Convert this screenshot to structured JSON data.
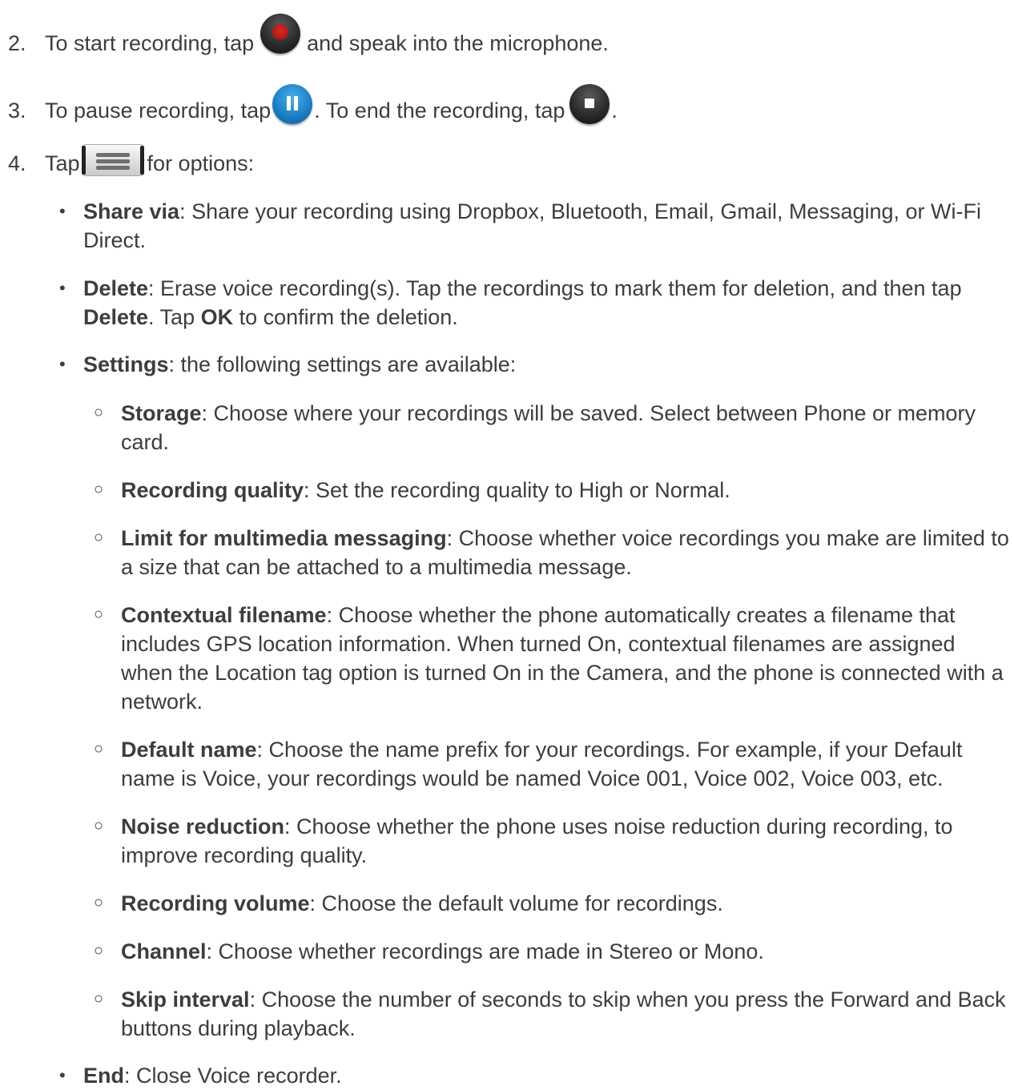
{
  "steps": [
    {
      "num": "2.",
      "pre": "To start recording, tap",
      "post": "and speak into the microphone."
    },
    {
      "num": "3.",
      "pre": "To pause recording, tap",
      "mid": ". To end the recording, tap",
      "post": "."
    },
    {
      "num": "4.",
      "pre": "Tap",
      "post": "for options:"
    }
  ],
  "icons": {
    "record": "record-button-icon",
    "pause": "pause-button-icon",
    "stop": "stop-button-icon",
    "menu": "menu-key-icon"
  },
  "options": {
    "share": {
      "term": "Share via",
      "text": ": Share your recording using Dropbox, Bluetooth, Email, Gmail, Messaging, or Wi-Fi Direct."
    },
    "delete": {
      "term": "Delete",
      "text1": ": Erase voice recording(s). Tap the recordings to mark them for deletion, and then tap ",
      "term2": "Delete",
      "text2": ". Tap ",
      "term3": "OK",
      "text3": " to confirm the deletion."
    },
    "settings": {
      "term": "Settings",
      "text": ": the following settings are available:"
    },
    "end": {
      "term": "End",
      "text": ": Close Voice recorder."
    }
  },
  "settings": [
    {
      "term": "Storage",
      "text": ": Choose where your recordings will be saved. Select between Phone or memory card."
    },
    {
      "term": "Recording quality",
      "text": ": Set the recording quality to High or Normal."
    },
    {
      "term": "Limit for multimedia messaging",
      "text": ": Choose whether voice recordings you make are limited to a size that can be attached to a multimedia message."
    },
    {
      "term": "Contextual filename",
      "text": ": Choose whether the phone automatically creates a filename that includes GPS location information. When turned On, contextual filenames are assigned when the Location tag option is turned On in the Camera, and the phone is connected with a network."
    },
    {
      "term": "Default name",
      "text": ": Choose the name prefix for your recordings. For example, if your Default name is Voice, your recordings would be named Voice 001, Voice 002, Voice 003, etc."
    },
    {
      "term": "Noise reduction",
      "text": ": Choose whether the phone uses noise reduction during recording, to improve recording quality."
    },
    {
      "term": "Recording volume",
      "text": ": Choose the default volume for recordings."
    },
    {
      "term": "Channel",
      "text": ": Choose whether recordings are made in Stereo or Mono."
    },
    {
      "term": "Skip interval",
      "text": ": Choose the number of seconds to skip when you press the Forward and Back buttons during playback."
    }
  ],
  "bullets": {
    "level1": "•",
    "level2": "○"
  }
}
